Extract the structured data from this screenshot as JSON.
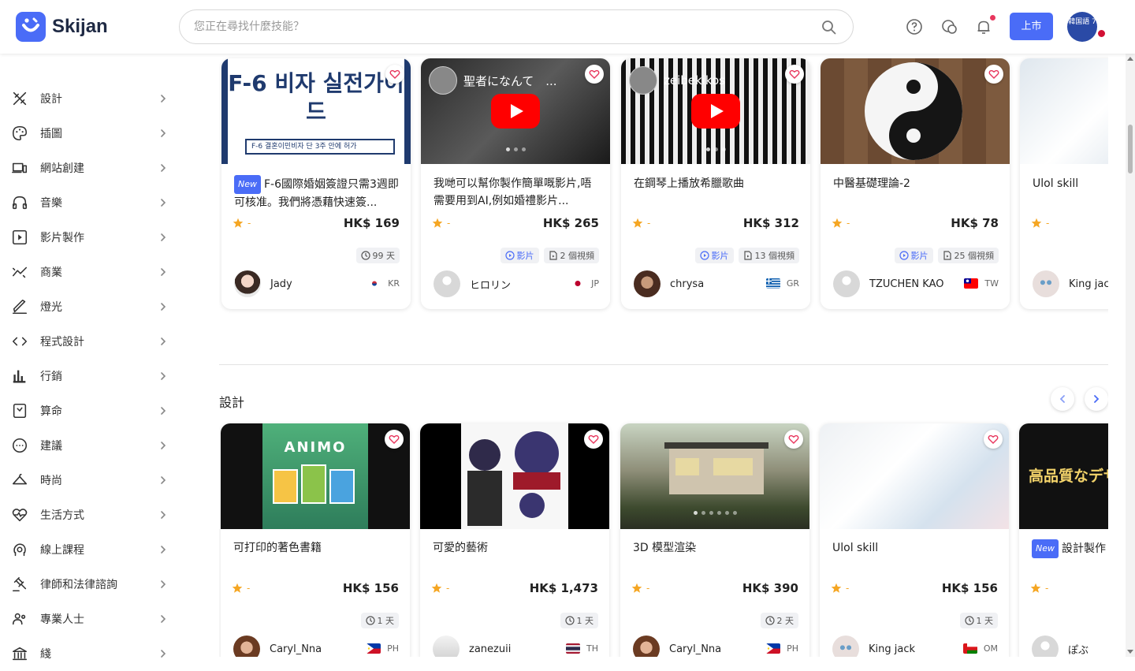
{
  "header": {
    "logo_text": "Skijan",
    "search_placeholder": "您正在尋找什麼技能？",
    "list_button": "上市",
    "avatar_text": "韓国語 7"
  },
  "sidebar": {
    "items": [
      {
        "label": "設計",
        "icon": "design-tools-icon"
      },
      {
        "label": "插圖",
        "icon": "palette-icon"
      },
      {
        "label": "網站創建",
        "icon": "devices-icon"
      },
      {
        "label": "音樂",
        "icon": "headphones-icon"
      },
      {
        "label": "影片製作",
        "icon": "video-icon"
      },
      {
        "label": "商業",
        "icon": "chart-trend-icon"
      },
      {
        "label": "燈光",
        "icon": "pen-icon"
      },
      {
        "label": "程式設計",
        "icon": "code-icon"
      },
      {
        "label": "行銷",
        "icon": "bar-chart-icon"
      },
      {
        "label": "算命",
        "icon": "fortune-icon"
      },
      {
        "label": "建議",
        "icon": "chat-bubble-icon"
      },
      {
        "label": "時尚",
        "icon": "hanger-icon"
      },
      {
        "label": "生活方式",
        "icon": "heartbeat-icon"
      },
      {
        "label": "線上課程",
        "icon": "online-course-icon"
      },
      {
        "label": "律師和法律諮詢",
        "icon": "gavel-icon"
      },
      {
        "label": "專業人士",
        "icon": "people-icon"
      },
      {
        "label": "綫",
        "icon": "bank-icon"
      }
    ]
  },
  "row1": [
    {
      "new": true,
      "title": "F-6國際婚姻簽證只需3週即可核准。我們將憑藉快速簽...",
      "rating": "-",
      "price": "HK$ 169",
      "tags": [
        {
          "type": "time",
          "label": "99 天"
        }
      ],
      "seller": "Jady",
      "country": "KR",
      "thumb_headline": "F-6 비자 실전가이드",
      "thumb_sub": "F-6 결혼이민비자 단 3주 안에 허가"
    },
    {
      "new": false,
      "title": "我哋可以幫你製作簡單嘅影片,唔需要用到AI,例如婚禮影片...",
      "rating": "-",
      "price": "HK$ 265",
      "tags": [
        {
          "type": "video",
          "label": "影片"
        },
        {
          "type": "file",
          "label": "2 個視頻"
        }
      ],
      "seller": "ヒロリン",
      "country": "JP",
      "yt_title": "聖者になんて　..."
    },
    {
      "new": false,
      "title": "在鋼琴上播放希臘歌曲",
      "rating": "-",
      "price": "HK$ 312",
      "tags": [
        {
          "type": "video",
          "label": "影片"
        },
        {
          "type": "file",
          "label": "13 個視頻"
        }
      ],
      "seller": "chrysa",
      "country": "GR",
      "yt_title": "zeibekikos"
    },
    {
      "new": false,
      "title": "中醫基礎理論-2",
      "rating": "-",
      "price": "HK$ 78",
      "tags": [
        {
          "type": "video",
          "label": "影片"
        },
        {
          "type": "file",
          "label": "25 個視頻"
        }
      ],
      "seller": "TZUCHEN KAO",
      "country": "TW"
    },
    {
      "new": false,
      "title": "Ulol skill",
      "rating": "-",
      "price": "",
      "tags": [],
      "seller": "King jack",
      "country": ""
    }
  ],
  "section2": {
    "title": "設計",
    "cards": [
      {
        "new": false,
        "title": "可打印的著色書籍",
        "rating": "-",
        "price": "HK$ 156",
        "time": "1 天",
        "seller": "Caryl_Nna",
        "country": "PH",
        "thumb_text": "ANIMO"
      },
      {
        "new": false,
        "title": "可愛的藝術",
        "rating": "-",
        "price": "HK$ 1,473",
        "time": "1 天",
        "seller": "zanezuii",
        "country": "TH"
      },
      {
        "new": false,
        "title": "3D 模型渲染",
        "rating": "-",
        "price": "HK$ 390",
        "time": "2 天",
        "seller": "Caryl_Nna",
        "country": "PH"
      },
      {
        "new": false,
        "title": "Ulol skill",
        "rating": "-",
        "price": "HK$ 156",
        "time": "1 天",
        "seller": "King jack",
        "country": "OM"
      },
      {
        "new": true,
        "title": "設計製作",
        "rating": "-",
        "price": "",
        "time": "",
        "seller": "ぽぶ",
        "country": "",
        "thumb_text": "高品質なデザ"
      }
    ]
  },
  "colors": {
    "accent": "#4a6cf7",
    "star": "#f5a623",
    "heart": "#e8365d"
  }
}
